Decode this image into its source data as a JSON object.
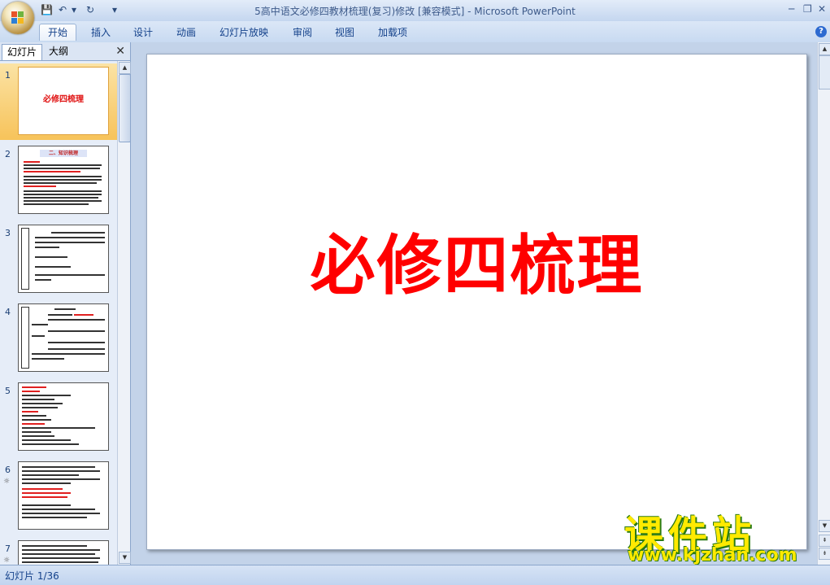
{
  "app": {
    "title": "5高中语文必修四教材梳理(复习)修改 [兼容模式] - Microsoft PowerPoint",
    "window_minimize": "─",
    "window_restore": "❐",
    "window_close": "✕"
  },
  "qat": {
    "save_icon": "💾",
    "undo_icon": "↶",
    "undo_menu": "▾",
    "redo_icon": "↻",
    "customize_icon": "▾"
  },
  "ribbon": {
    "tabs": [
      {
        "label": "开始",
        "active": true
      },
      {
        "label": "插入"
      },
      {
        "label": "设计"
      },
      {
        "label": "动画"
      },
      {
        "label": "幻灯片放映"
      },
      {
        "label": "审阅"
      },
      {
        "label": "视图"
      },
      {
        "label": "加载项"
      }
    ],
    "help_icon": "?"
  },
  "panel": {
    "tab_slides": "幻灯片",
    "tab_outline": "大纲",
    "close": "✕",
    "slides": [
      {
        "num": "1",
        "title": "必修四梳理",
        "selected": true
      },
      {
        "num": "2",
        "title": "二、知识梳理"
      },
      {
        "num": "3"
      },
      {
        "num": "4"
      },
      {
        "num": "5"
      },
      {
        "num": "6",
        "has_icon": true
      },
      {
        "num": "7",
        "has_icon": true
      }
    ],
    "slide_icon": "☼"
  },
  "slide": {
    "title": "必修四梳理"
  },
  "watermark": {
    "brand": "课件站",
    "url": "www.kjzhan.com"
  },
  "status": {
    "text": "幻灯片 1/36"
  },
  "colors": {
    "accent": "#15428b",
    "slide_title": "#ff0000",
    "selected": "#f7c35a"
  }
}
